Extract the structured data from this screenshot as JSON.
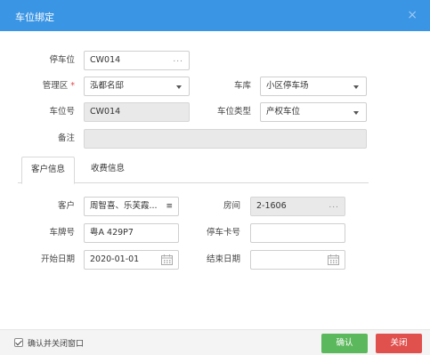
{
  "dialog": {
    "title": "车位绑定",
    "close_glyph": "×"
  },
  "form": {
    "space": {
      "label": "停车位",
      "value": "CW014",
      "picker": "..."
    },
    "area": {
      "label": "管理区",
      "required_mark": "*",
      "value": "泓都名邸"
    },
    "garage": {
      "label": "车库",
      "value": "小区停车场"
    },
    "space_no": {
      "label": "车位号",
      "value": "CW014"
    },
    "space_type": {
      "label": "车位类型",
      "value": "产权车位"
    },
    "remark": {
      "label": "备注",
      "value": ""
    }
  },
  "tabs": [
    {
      "label": "客户信息",
      "active": true
    },
    {
      "label": "收费信息",
      "active": false
    }
  ],
  "customer": {
    "client": {
      "label": "客户",
      "value": "周智喜、乐芙霞...",
      "menu_glyph": "≡"
    },
    "room": {
      "label": "房间",
      "value": "2-1606",
      "picker": "..."
    },
    "plate": {
      "label": "车牌号",
      "value": "粤A 429P7"
    },
    "card": {
      "label": "停车卡号",
      "value": ""
    },
    "start": {
      "label": "开始日期",
      "value": "2020-01-01"
    },
    "end": {
      "label": "结束日期",
      "value": ""
    }
  },
  "footer": {
    "checkbox_label": "确认并关闭窗口",
    "checked": true,
    "ok_label": "确认",
    "cancel_label": "关闭"
  },
  "colors": {
    "titlebar": "#3a95e4",
    "ok": "#5cb85c",
    "cancel": "#e0514e",
    "required": "#e64545"
  },
  "icons": {
    "calendar": "calendar-icon",
    "dropdown": "chevron-down-icon",
    "menu": "menu-icon"
  }
}
